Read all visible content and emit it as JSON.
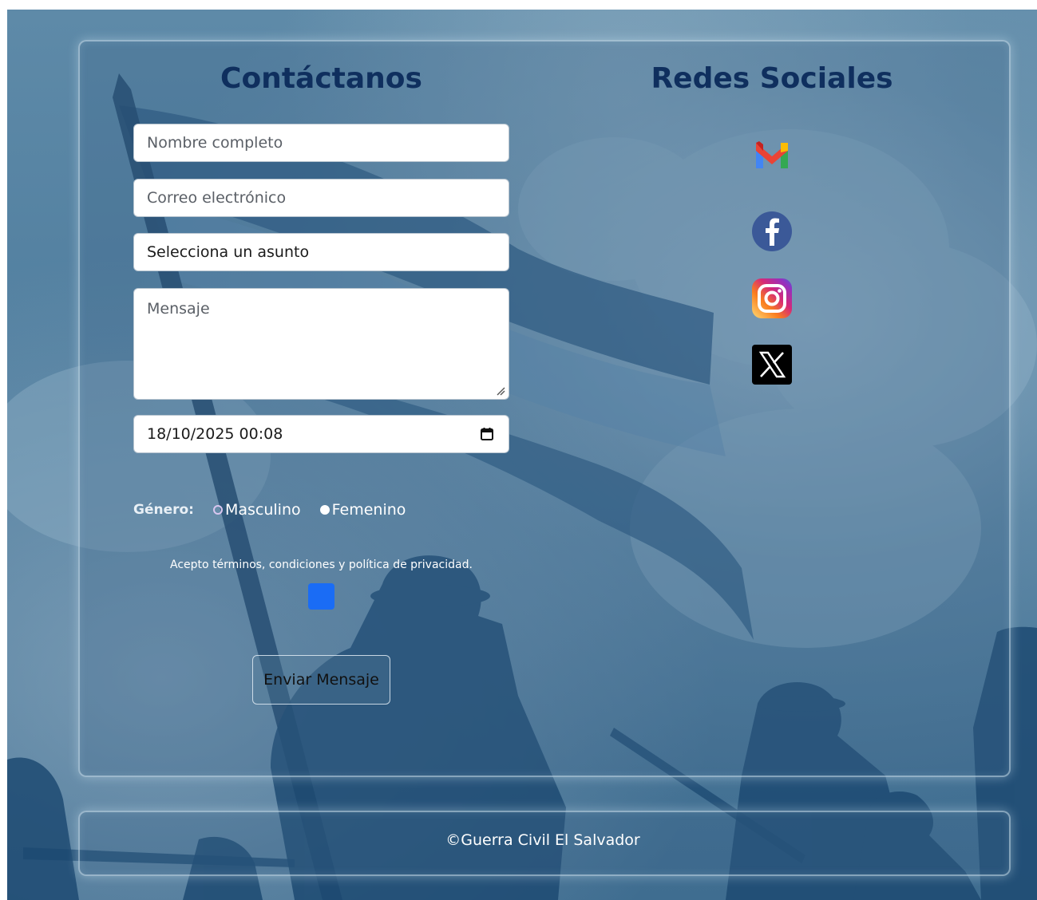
{
  "contact": {
    "title": "Contáctanos",
    "name_placeholder": "Nombre completo",
    "email_placeholder": "Correo electrónico",
    "subject_selected": "Selecciona un asunto",
    "message_placeholder": "Mensaje",
    "datetime_value": "18/10/2025 00:08",
    "gender": {
      "label": "Género:",
      "options": [
        {
          "label": "Masculino",
          "selected": false
        },
        {
          "label": "Femenino",
          "selected": true
        }
      ]
    },
    "terms_label": "Acepto términos, condiciones y política de privacidad.",
    "terms_checked": true,
    "submit_label": "Enviar Mensaje"
  },
  "social": {
    "title": "Redes Sociales",
    "icons": [
      "gmail-icon",
      "facebook-icon",
      "instagram-icon",
      "x-icon"
    ]
  },
  "footer": {
    "text": "©Guerra Civil El Salvador"
  },
  "colors": {
    "heading": "#0f2f5e",
    "checkbox_accent": "#1a6cf5"
  }
}
